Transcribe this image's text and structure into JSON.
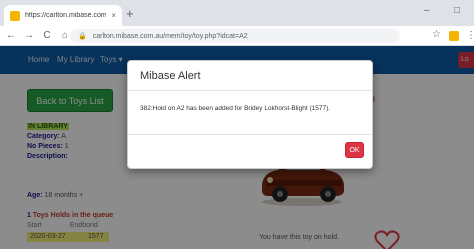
{
  "browser": {
    "tab_title": "https://carlton.mibase.com.au/m",
    "tab_close": "×",
    "new_tab": "+",
    "window": {
      "minimize": "–",
      "maximize": "□"
    },
    "nav": {
      "back": "←",
      "forward": "→",
      "reload": "C",
      "home": "⌂"
    },
    "url": "carlton.mibase.com.au/mem/toy/toy.php?idcat=A2"
  },
  "site_nav": {
    "items": [
      "Home",
      "My Library",
      "Toys ▾"
    ],
    "login_label": "Lo"
  },
  "page": {
    "back_button": "Back to Toys List",
    "title_fragment": "n",
    "status": "IN LIBRARY",
    "category_label": "Category:",
    "category_value": "A",
    "pieces_label": "No Pieces:",
    "pieces_value": "1",
    "description_label": "Description:",
    "age_label": "Age:",
    "age_value": "18 months +",
    "holds_count": "1",
    "holds_title": "Toys Holds in the queue",
    "holds_columns": [
      "Start",
      "Endborid"
    ],
    "holds_rows": [
      [
        "2020-03-27",
        "1577"
      ]
    ],
    "on_hold_text": "You have this toy on hold."
  },
  "modal": {
    "title": "Mibase Alert",
    "message": "382:Hold on A2 has been added for Bridey Lokhorst-Blight (1577).",
    "ok_label": "OK"
  },
  "colors": {
    "nav_bg": "#0d5ca6",
    "back_button": "#28a745",
    "ok_button": "#dc3545",
    "holds_row": "#f3ee77"
  }
}
